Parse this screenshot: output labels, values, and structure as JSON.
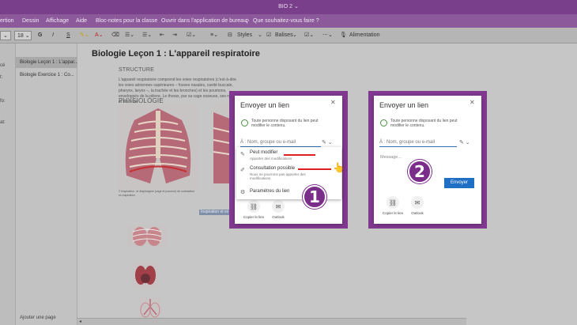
{
  "title_bar": {
    "title": "BIO 2 ⌄"
  },
  "menu": {
    "items": [
      "ertion",
      "Dessin",
      "Affichage",
      "Aide",
      "Bloc-notes pour la classe",
      "Ouvrir dans l'application de bureau"
    ],
    "tell_me": "Que souhaitez-vous faire ?"
  },
  "toolbar": {
    "font_size": "18",
    "bold": "G",
    "italic": "I",
    "underline": "S",
    "styles": "Styles",
    "tags": "Balises",
    "dictate": "Alimentation"
  },
  "left_rail": {
    "labels": [
      "cé",
      "t:",
      "fo:",
      "at:"
    ]
  },
  "page_list": {
    "items": [
      "Biologie Leçon 1 : L'appar...",
      "Biologie Exercice 1 : Co..."
    ],
    "selected": 0,
    "add_page": "Ajouter une page"
  },
  "page": {
    "title": "Biologie Leçon 1 : L'appareil respiratoire",
    "heading_structure": "STRUCTURE",
    "body": "L'appareil respiratoire comprend les voies respiratoires (c'est-à-dire les voies aériennes supérieures – fosses nasales, cavité buccale, pharynx, larynx –, la trachée et les bronches) et les poumons, enveloppés de la plèvre. Le thorax, par sa cage osseuse, ses nerfs et ses mus",
    "heading_physiology": "PHYSIOLOGIE",
    "caption": "© Inspiration : le diaphragme (cage et poumon) de contraction en inspiration",
    "highlighted_text": "Inspiration et ex"
  },
  "dialog1": {
    "title": "Envoyer un lien",
    "info": "Toute personne disposant du lien peut modifier le contenu.",
    "recipient_placeholder": "À : Nom, groupe ou e-mail",
    "menu": {
      "can_edit_title": "Peut modifier",
      "can_edit_sub": "Apporter des modifications",
      "view_only_title": "Consultation possible",
      "view_only_sub": "Nous ne pourrons pas apporter des modifications",
      "settings": "Paramètres du lien"
    },
    "copy_link": "Copier le lien",
    "outlook": "Outlook",
    "badge": "1"
  },
  "dialog2": {
    "title": "Envoyer un lien",
    "info": "Toute personne disposant du lien peut modifier le contenu.",
    "recipient_placeholder": "À : Nom, groupe ou e-mail",
    "message_placeholder": "Message...",
    "send": "Envoyer",
    "copy_link": "Copier le lien",
    "outlook": "Outlook",
    "badge": "2"
  },
  "colors": {
    "titlebar": "#7a3f8b",
    "panel": "#80398f",
    "accent": "#1f6fc5",
    "underline_red": "#e02020"
  }
}
